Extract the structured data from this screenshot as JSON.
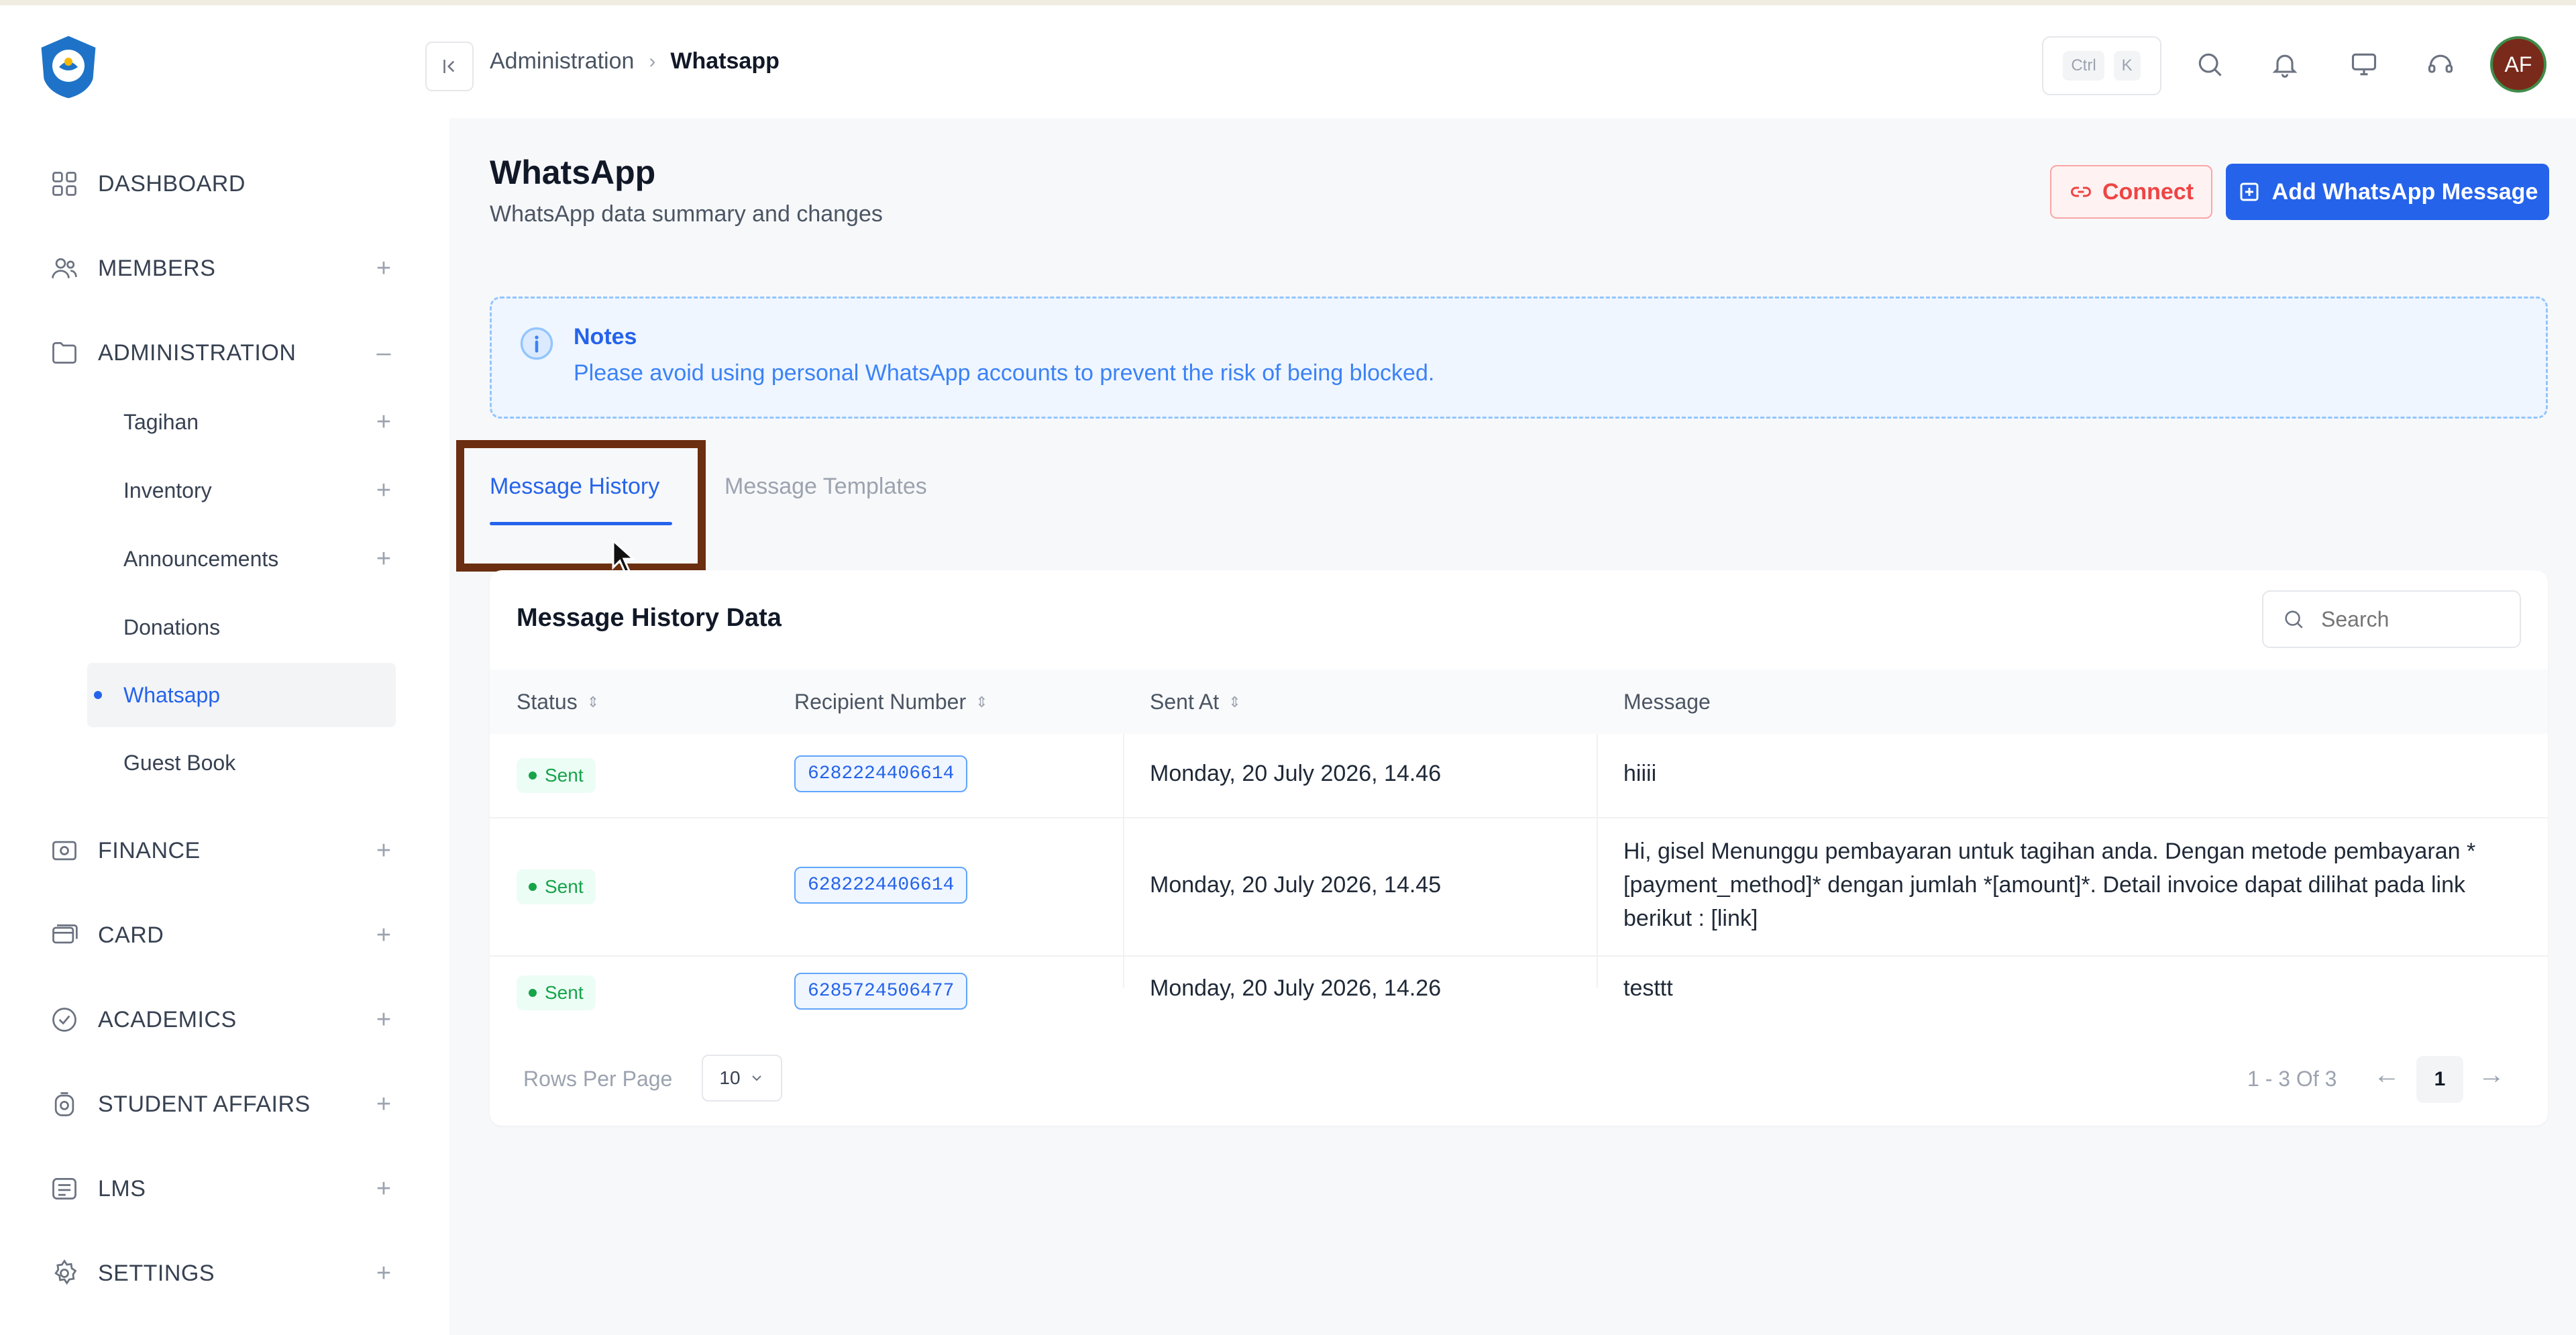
{
  "header": {
    "breadcrumb": [
      "Administration",
      "Whatsapp"
    ],
    "kbd": [
      "Ctrl",
      "K"
    ],
    "avatar": "AF"
  },
  "sidebar": {
    "items": [
      {
        "label": "DASHBOARD",
        "icon": "grid-icon",
        "toggle": ""
      },
      {
        "label": "MEMBERS",
        "icon": "users-icon",
        "toggle": "+"
      },
      {
        "label": "ADMINISTRATION",
        "icon": "folder-icon",
        "toggle": "–"
      },
      {
        "label": "FINANCE",
        "icon": "wallet-icon",
        "toggle": "+"
      },
      {
        "label": "CARD",
        "icon": "card-icon",
        "toggle": "+"
      },
      {
        "label": "ACADEMICS",
        "icon": "academic-icon",
        "toggle": "+"
      },
      {
        "label": "STUDENT AFFAIRS",
        "icon": "student-icon",
        "toggle": "+"
      },
      {
        "label": "LMS",
        "icon": "lms-icon",
        "toggle": "+"
      },
      {
        "label": "SETTINGS",
        "icon": "gear-icon",
        "toggle": "+"
      }
    ],
    "sub_items": [
      {
        "label": "Tagihan",
        "toggle": "+"
      },
      {
        "label": "Inventory",
        "toggle": "+"
      },
      {
        "label": "Announcements",
        "toggle": "+"
      },
      {
        "label": "Donations",
        "toggle": ""
      },
      {
        "label": "Whatsapp",
        "toggle": ""
      },
      {
        "label": "Guest Book",
        "toggle": ""
      }
    ]
  },
  "page": {
    "title": "WhatsApp",
    "subtitle": "WhatsApp data summary and changes",
    "connect_label": "Connect",
    "add_label": "Add WhatsApp Message"
  },
  "notes": {
    "title": "Notes",
    "body": "Please avoid using personal WhatsApp accounts to prevent the risk of being blocked."
  },
  "tabs": [
    "Message History",
    "Message Templates"
  ],
  "table": {
    "title": "Message History Data",
    "search_placeholder": "Search",
    "columns": [
      "Status",
      "Recipient Number",
      "Sent At",
      "Message"
    ],
    "rows": [
      {
        "status": "Sent",
        "number": "6282224406614",
        "sent_at": "Monday, 20 July 2026, 14.46",
        "message": "hiiii"
      },
      {
        "status": "Sent",
        "number": "6282224406614",
        "sent_at": "Monday, 20 July 2026, 14.45",
        "message": "Hi, gisel Menunggu pembayaran untuk tagihan anda. Dengan metode pembayaran *[payment_method]* dengan jumlah *[amount]*. Detail invoice dapat dilihat pada link berikut : [link]"
      },
      {
        "status": "Sent",
        "number": "6285724506477",
        "sent_at": "Monday, 20 July 2026, 14.26",
        "message": "testtt"
      }
    ],
    "rows_per_page_label": "Rows Per Page",
    "rows_per_page": "10",
    "page_info": "1 - 3 Of 3",
    "current_page": "1"
  },
  "colors": {
    "accent": "#2563eb",
    "danger": "#ef4444",
    "success": "#16a34a",
    "highlight_box": "#6b2e10"
  }
}
